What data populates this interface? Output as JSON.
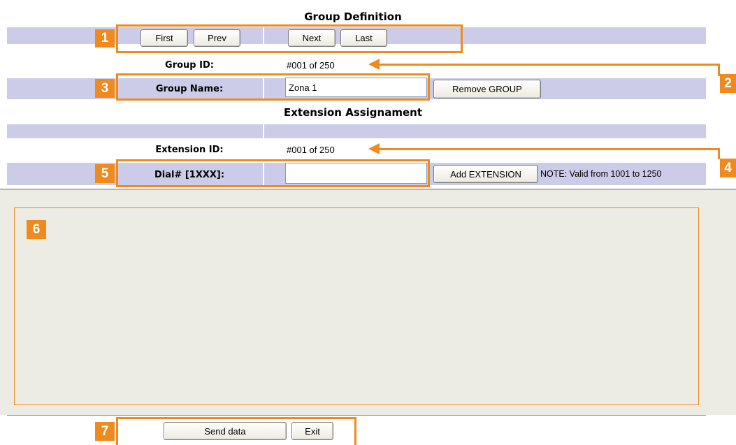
{
  "group_section": {
    "title": "Group Definition",
    "nav": {
      "first_label": "First",
      "prev_label": "Prev",
      "next_label": "Next",
      "last_label": "Last"
    },
    "group_id": {
      "label": "Group ID:",
      "value": "#001 of 250"
    },
    "group_name": {
      "label": "Group Name:",
      "value": "Zona 1",
      "remove_label": "Remove GROUP"
    }
  },
  "extension_section": {
    "title": "Extension Assignament",
    "extension_id": {
      "label": "Extension ID:",
      "value": "#001 of 250"
    },
    "dial": {
      "label": "Dial# [1XXX]:",
      "value": "",
      "add_label": "Add EXTENSION",
      "note": "NOTE: Valid from 1001 to 1250"
    }
  },
  "footer": {
    "send_label": "Send data",
    "exit_label": "Exit"
  },
  "callouts": [
    "1",
    "2",
    "3",
    "4",
    "5",
    "6",
    "7"
  ],
  "colors": {
    "accent": "#ef8a1f",
    "band": "#cccce8",
    "panel": "#edece4"
  }
}
